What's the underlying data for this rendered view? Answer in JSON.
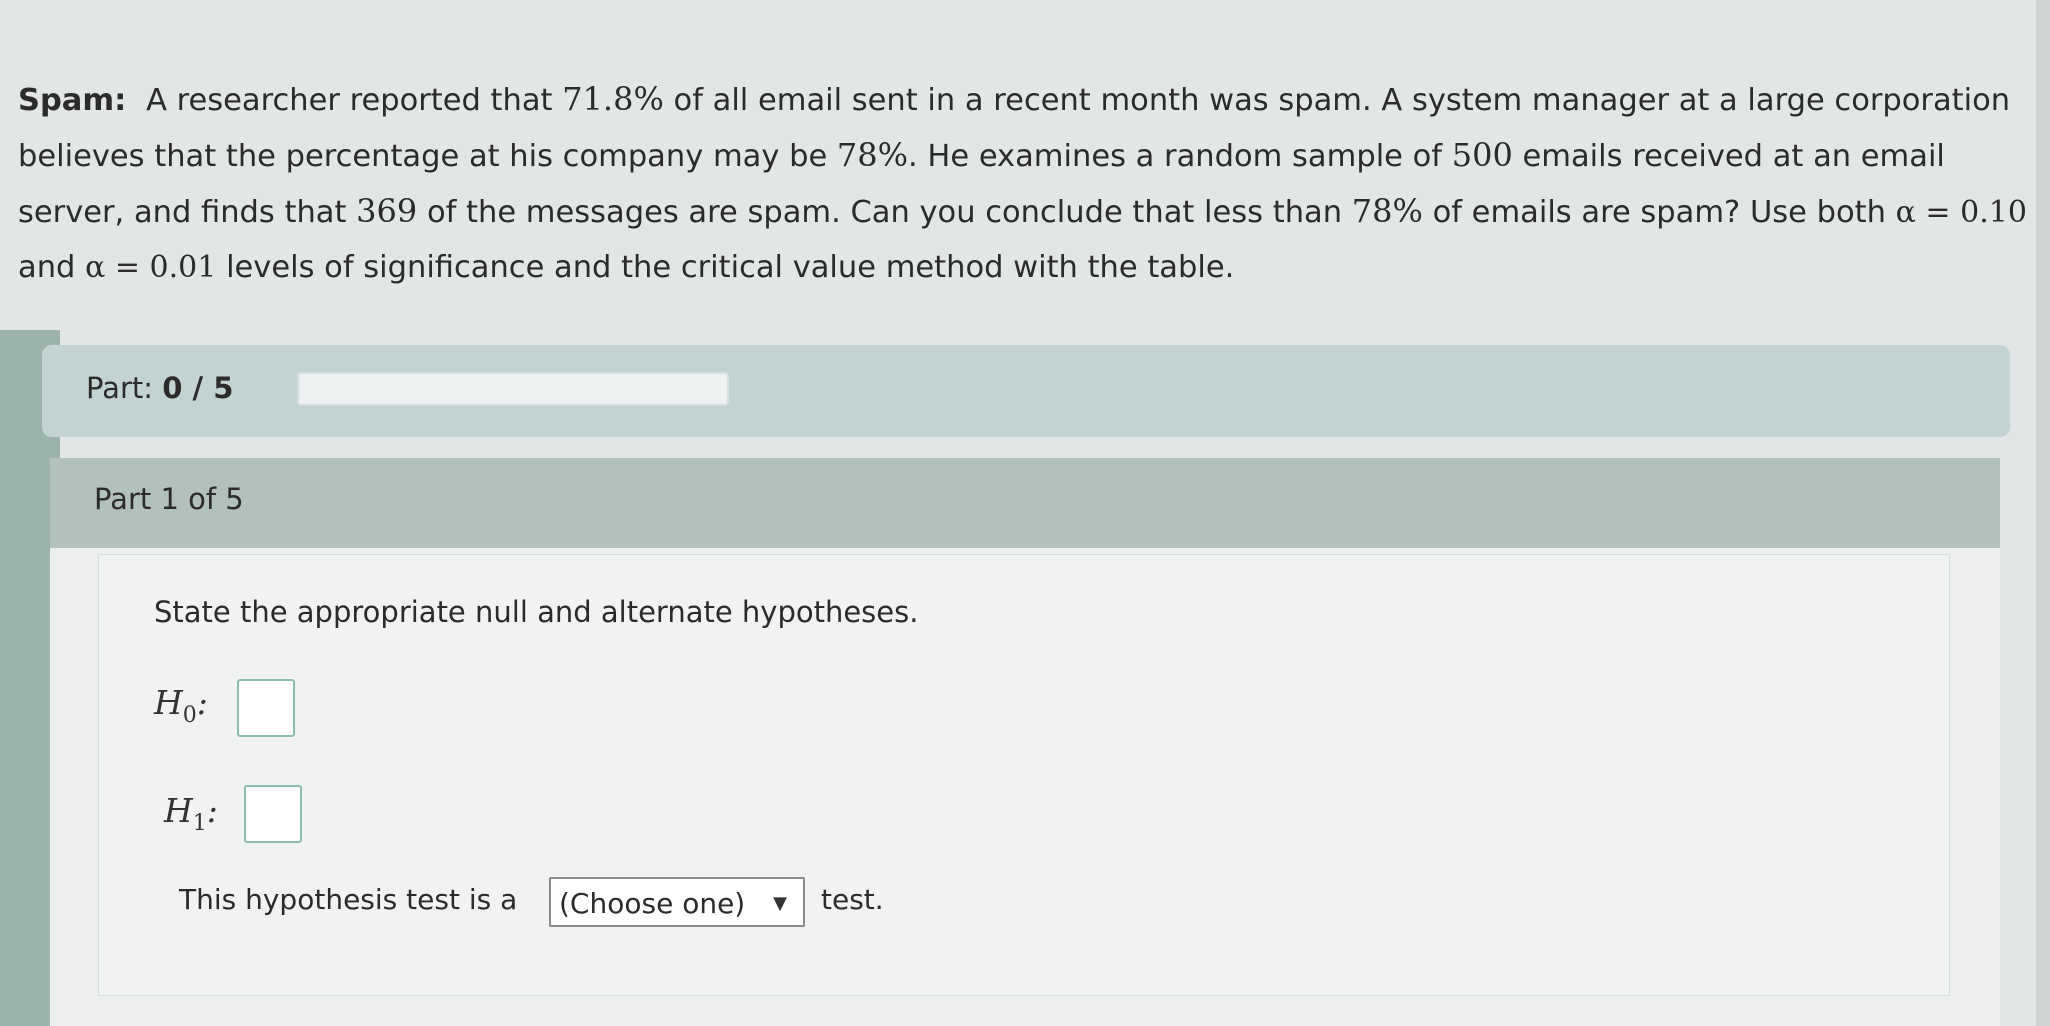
{
  "problem": {
    "label": "Spam:",
    "seg1": "A researcher reported that",
    "p0": "71.8%",
    "seg2": "of all email sent in a recent month was spam. A system manager at a large corporation believes that the percentage at his company may be",
    "p_claim": "78%",
    "seg3": ". He examines a random sample of",
    "n": "500",
    "seg4": "emails received at an email server, and finds that",
    "x": "369",
    "seg5": "of the messages are spam. Can you conclude that less than",
    "p_claim2": "78%",
    "seg6": "of emails are spam? Use both",
    "alpha1": "α = 0.10",
    "seg7": "and",
    "alpha2": "α = 0.01",
    "seg8": "levels of significance and the critical value method with the table."
  },
  "progress": {
    "label": "Part:",
    "value": "0 / 5",
    "fraction": 0.0
  },
  "part": {
    "header": "Part 1 of 5",
    "instruction": "State the appropriate null and alternate hypotheses.",
    "h0_label": "H",
    "h0_sub": "0",
    "h1_label": "H",
    "h1_sub": "1",
    "colon": ":",
    "h0_value": "",
    "h1_value": "",
    "sentence_start": "This hypothesis test is a",
    "select_value": "(Choose one)",
    "sentence_end": "test."
  },
  "icons": {
    "select_caret": "caret-down-icon"
  }
}
